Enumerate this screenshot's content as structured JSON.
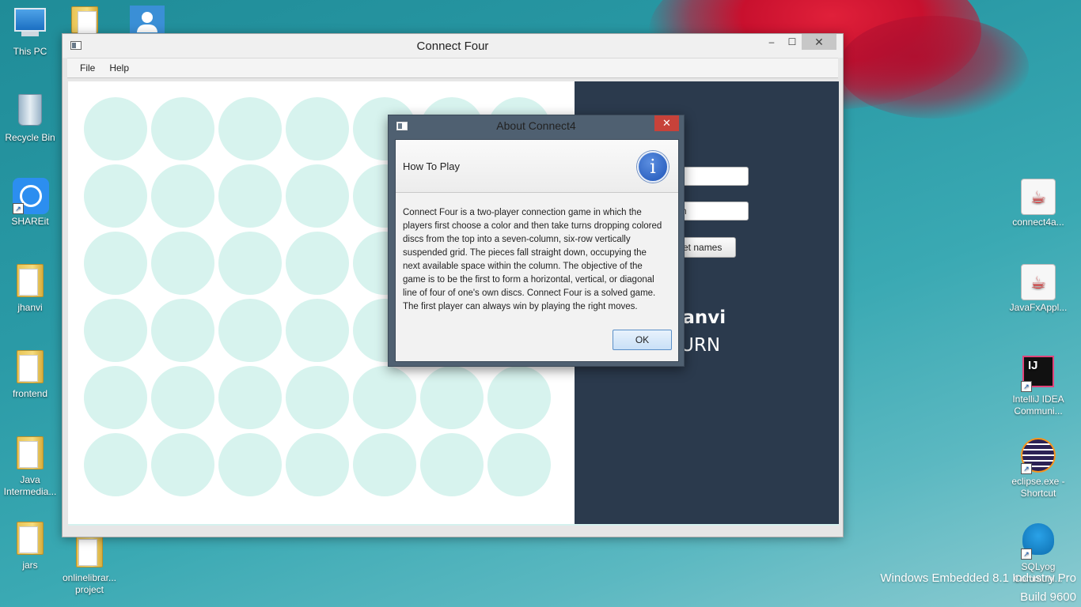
{
  "desktop": {
    "icons_left": [
      {
        "label": "This PC"
      },
      {
        "label": "Recycle Bin"
      },
      {
        "label": "SHAREit"
      },
      {
        "label": "jhanvi"
      },
      {
        "label": "frontend"
      },
      {
        "label": "Java Intermedia..."
      },
      {
        "label": "jars"
      }
    ],
    "icons_bottom": [
      {
        "label": "onlinelibrar... project"
      }
    ],
    "icons_right": [
      {
        "label": "connect4a..."
      },
      {
        "label": "JavaFxAppl..."
      },
      {
        "label": "IntelliJ IDEA Communi..."
      },
      {
        "label": "eclipse.exe - Shortcut"
      },
      {
        "label": "SQLyog Communi..."
      }
    ],
    "watermark": {
      "line1": "Windows Embedded 8.1 Industry Pro",
      "line2": "Build 9600"
    }
  },
  "window": {
    "title": "Connect Four",
    "minimize": "–",
    "maximize": "☐",
    "close": "✕",
    "menu": [
      {
        "label": "File"
      },
      {
        "label": "Help"
      }
    ],
    "board": {
      "rows": 6,
      "columns": 7,
      "empty_color": "#d7f3ee"
    },
    "side_panel": {
      "field1_value": "",
      "field2_value": "n",
      "set_names_button": "et names",
      "player_name": "hanvi",
      "turn_text": "TURN",
      "background": "#2b3a4d"
    }
  },
  "dialog": {
    "title": "About Connect4",
    "close": "✕",
    "header": "How To Play",
    "info_icon": "i",
    "body": "Connect Four is a two-player connection game in which the players first choose a color and then take turns dropping colored discs from the top into a seven-column, six-row vertically suspended grid. The pieces fall straight down, occupying the next available space within the column. The objective of the game is to be the first to form a horizontal, vertical, or diagonal line of four of one's own discs. Connect Four is a solved game. The first player can always win by playing the right moves.",
    "ok_label": "OK"
  }
}
